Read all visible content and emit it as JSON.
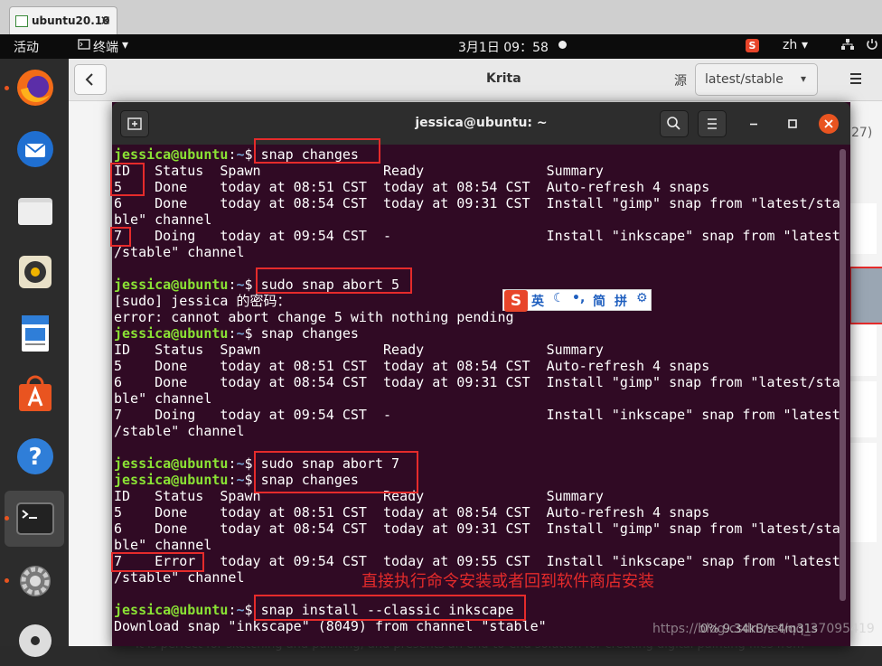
{
  "vm": {
    "tab_label": "ubuntu20.10",
    "close_glyph": "✕"
  },
  "topbar": {
    "activities": "活动",
    "app_menu": "终端",
    "datetime": "3月1日 09：58",
    "ime_lang": "zh",
    "dropdown_glyph": "▾"
  },
  "dock": {
    "items": [
      "firefox-icon",
      "thunderbird-icon",
      "files-icon",
      "rhythmbox-icon",
      "libreoffice-writer-icon",
      "ubuntu-software-icon",
      "help-icon",
      "terminal-icon",
      "settings-icon",
      "dvd-icon"
    ]
  },
  "store": {
    "title": "Krita",
    "source_label": "源",
    "channel": "latest/stable",
    "side_count": "27)",
    "description": "It is perfect for sketching and painting, and presents an end-to-end solution for creating digital painting files from",
    "status": "0%   9.34kB/s 4m31s"
  },
  "terminal": {
    "title": "jessica@ubuntu: ~",
    "prompt_user": "jessica@ubuntu",
    "lines": [
      {
        "prompt": true,
        "cmd": "snap changes"
      },
      {
        "text": "ID   Status  Spawn               Ready               Summary"
      },
      {
        "text": "5    Done    today at 08:51 CST  today at 08:54 CST  Auto-refresh 4 snaps"
      },
      {
        "text": "6    Done    today at 08:54 CST  today at 09:31 CST  Install \"gimp\" snap from \"latest/sta"
      },
      {
        "text": "ble\" channel"
      },
      {
        "text": "7    Doing   today at 09:54 CST  -                   Install \"inkscape\" snap from \"latest"
      },
      {
        "text": "/stable\" channel"
      },
      {
        "text": ""
      },
      {
        "prompt": true,
        "cmd": "sudo snap abort 5"
      },
      {
        "text": "[sudo] jessica 的密码："
      },
      {
        "text": "error: cannot abort change 5 with nothing pending"
      },
      {
        "prompt": true,
        "cmd": "snap changes"
      },
      {
        "text": "ID   Status  Spawn               Ready               Summary"
      },
      {
        "text": "5    Done    today at 08:51 CST  today at 08:54 CST  Auto-refresh 4 snaps"
      },
      {
        "text": "6    Done    today at 08:54 CST  today at 09:31 CST  Install \"gimp\" snap from \"latest/sta"
      },
      {
        "text": "ble\" channel"
      },
      {
        "text": "7    Doing   today at 09:54 CST  -                   Install \"inkscape\" snap from \"latest"
      },
      {
        "text": "/stable\" channel"
      },
      {
        "text": ""
      },
      {
        "prompt": true,
        "cmd": "sudo snap abort 7"
      },
      {
        "prompt": true,
        "cmd": "snap changes"
      },
      {
        "text": "ID   Status  Spawn               Ready               Summary"
      },
      {
        "text": "5    Done    today at 08:51 CST  today at 08:54 CST  Auto-refresh 4 snaps"
      },
      {
        "text": "6    Done    today at 08:54 CST  today at 09:31 CST  Install \"gimp\" snap from \"latest/sta"
      },
      {
        "text": "ble\" channel"
      },
      {
        "text": "7    Error   today at 09:54 CST  today at 09:55 CST  Install \"inkscape\" snap from \"latest"
      },
      {
        "text": "/stable\" channel"
      },
      {
        "text": ""
      },
      {
        "prompt": true,
        "cmd": "snap install --classic inkscape"
      },
      {
        "text": "Download snap \"inkscape\" (8049) from channel \"stable\""
      }
    ]
  },
  "ime": {
    "mode": "英",
    "simplified": "简",
    "pinyin": "拼"
  },
  "annotation": {
    "text": "直接执行命令安装或者回到软件商店安装"
  },
  "watermark": "https://blog.csdn.net/qq_37095419",
  "colors": {
    "terminal_bg": "#300a24",
    "prompt_user": "#8ae234",
    "prompt_path": "#729fcf",
    "highlight": "#e52b2b",
    "accent": "#e95420"
  }
}
